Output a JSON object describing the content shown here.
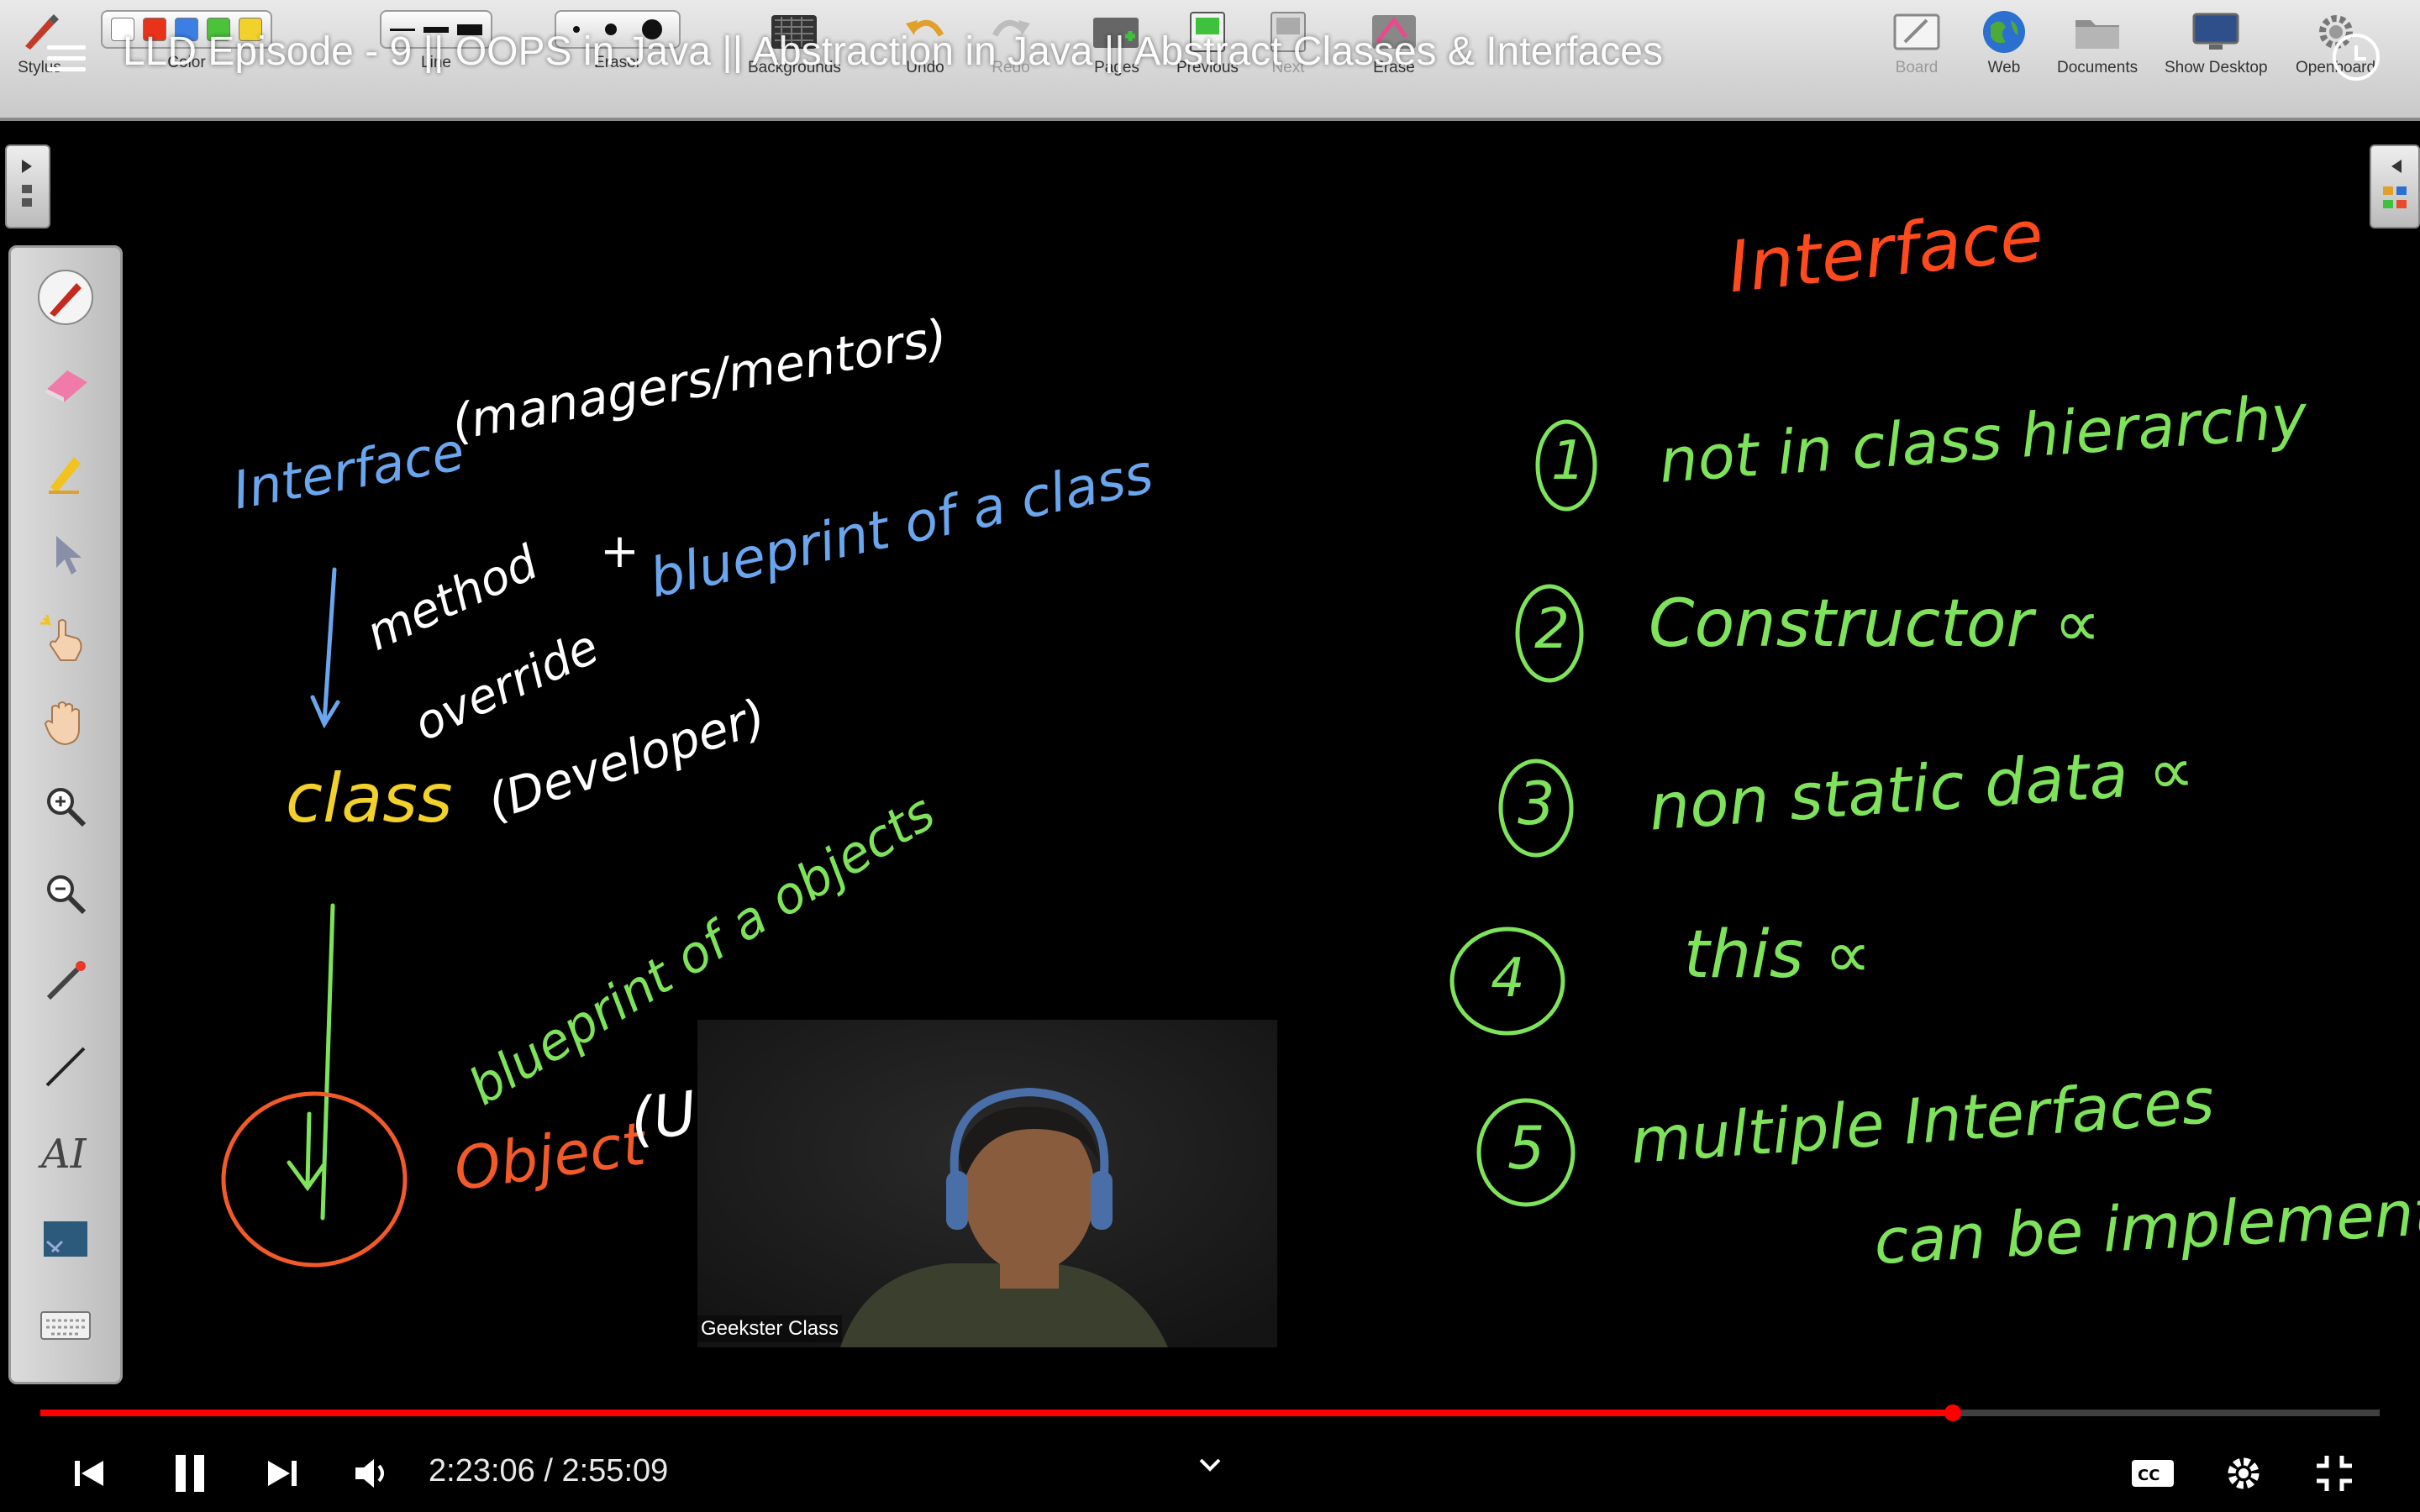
{
  "video": {
    "title": "LLD Episode - 9 || OOPS in Java || Abstraction in Java || Abstract Classes & Interfaces",
    "time_current": "2:23:06",
    "time_separator": " / ",
    "time_total": "2:55:09",
    "progress": 0.8175
  },
  "toolbar": {
    "groups": {
      "stylus": "Stylus",
      "color": "Color",
      "line": "Line",
      "eraser": "Eraser",
      "backgrounds": "Backgrounds",
      "undo": "Undo",
      "redo": "Redo",
      "pages": "Pages",
      "previous": "Previous",
      "next": "Next",
      "erase": "Erase",
      "board": "Board",
      "web": "Web",
      "documents": "Documents",
      "show_desktop": "Show Desktop",
      "openboard": "Openboard"
    },
    "color_swatches": [
      "#ffffff",
      "#e8331a",
      "#3b7fe3",
      "#4cc23a",
      "#f2d12a"
    ]
  },
  "board": {
    "left": {
      "interface_heading": "Interface",
      "interface_note": "(managers/mentors)",
      "method_override_1": "method",
      "method_override_2": "override",
      "plus": "+",
      "blueprint_class": "blueprint of a class",
      "class_heading": "class",
      "class_note": "(Developer)",
      "blueprint_objects": "blueprint of a objects",
      "object_heading": "Object",
      "object_note": "(Us"
    },
    "right": {
      "title": "Interface",
      "points": [
        {
          "num": "1",
          "text": "not in class hierarchy"
        },
        {
          "num": "2",
          "text": "Constructor ∝"
        },
        {
          "num": "3",
          "text": "non static data ∝"
        },
        {
          "num": "4",
          "text": "this ∝"
        },
        {
          "num": "5",
          "text": "multiple Interfaces",
          "text2": "can be implemented"
        }
      ]
    },
    "colors": {
      "blue": "#6aa6ee",
      "white": "#ffffff",
      "yellow": "#f2d12a",
      "green": "#7ee35a",
      "orange": "#f25a2a",
      "red_title": "#ff4a1e"
    }
  },
  "webcam": {
    "label": "Geekster Class"
  }
}
